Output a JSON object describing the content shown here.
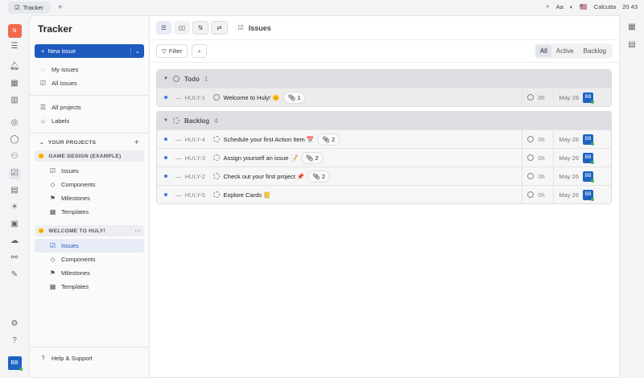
{
  "tabbar": {
    "tab": "Tracker",
    "add": "+"
  },
  "topright": {
    "font": "Aa",
    "location": "Calcutta",
    "time": "20 43"
  },
  "rail": {
    "workspace": "N",
    "user": "BB"
  },
  "sidebar": {
    "title": "Tracker",
    "new_issue": "New issue",
    "items": [
      "My issues",
      "All issues",
      "All projects",
      "Labels"
    ],
    "your_projects": "YOUR PROJECTS",
    "projects": [
      {
        "name": "GAME DESIGN (EXAMPLE)",
        "items": [
          "Issues",
          "Components",
          "Milestones",
          "Templates"
        ]
      },
      {
        "name": "WELCOME TO HULY!",
        "items": [
          "Issues",
          "Components",
          "Milestones",
          "Templates"
        ]
      }
    ],
    "help": "Help & Support"
  },
  "header": {
    "title": "Issues",
    "filter": "Filter",
    "tabs": [
      "All",
      "Active",
      "Backlog"
    ]
  },
  "groups": [
    {
      "name": "Todo",
      "count": "1",
      "issues": [
        {
          "id": "HULY-1",
          "title": "Welcome to Huly! 🌞",
          "attach": "1",
          "est": "0h",
          "date": "May 26",
          "assignee": "BB"
        }
      ]
    },
    {
      "name": "Backlog",
      "count": "4",
      "issues": [
        {
          "id": "HULY-4",
          "title": "Schedule your first Action Item 📅",
          "attach": "2",
          "est": "0h",
          "date": "May 26",
          "assignee": "BB"
        },
        {
          "id": "HULY-3",
          "title": "Assign yourself an issue 📝",
          "attach": "2",
          "est": "0h",
          "date": "May 26",
          "assignee": "BB"
        },
        {
          "id": "HULY-2",
          "title": "Check out your first project 📌",
          "attach": "2",
          "est": "0h",
          "date": "May 26",
          "assignee": "BB"
        },
        {
          "id": "HULY-5",
          "title": "Explore Cards 📒",
          "attach": null,
          "est": "0h",
          "date": "May 26",
          "assignee": "BB"
        }
      ]
    }
  ]
}
